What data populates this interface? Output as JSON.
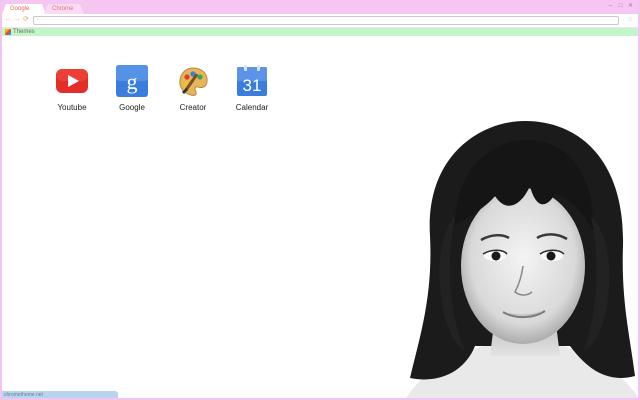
{
  "tabs": [
    {
      "label": "Google",
      "active": true
    },
    {
      "label": "Chrome",
      "active": false
    }
  ],
  "window_controls": [
    "minimize",
    "maximize",
    "close"
  ],
  "toolbar": {
    "back_icon": "back-arrow-icon",
    "forward_icon": "forward-arrow-icon",
    "reload_icon": "reload-icon",
    "omnibox_value": "",
    "star_icon": "star-icon"
  },
  "bookmarks": [
    {
      "label": "Themes",
      "icon": "themes-icon"
    }
  ],
  "apps": [
    {
      "label": "Youtube",
      "icon": "youtube-icon",
      "color": "#e52d27"
    },
    {
      "label": "Google",
      "icon": "google-icon",
      "color": "#3b7ddd"
    },
    {
      "label": "Creator",
      "icon": "creator-palette-icon",
      "color": "#e6a640"
    },
    {
      "label": "Calendar",
      "icon": "calendar-icon",
      "color": "#3b7ddd",
      "day": "31"
    }
  ],
  "status_bar": {
    "text": "chrometheme.net"
  },
  "colors": {
    "tabstrip": "#f6c6f3",
    "bookmarks_bar": "#c4f5c8",
    "status_bar": "#b7d4ef",
    "tab_text": "#e06d5a"
  }
}
